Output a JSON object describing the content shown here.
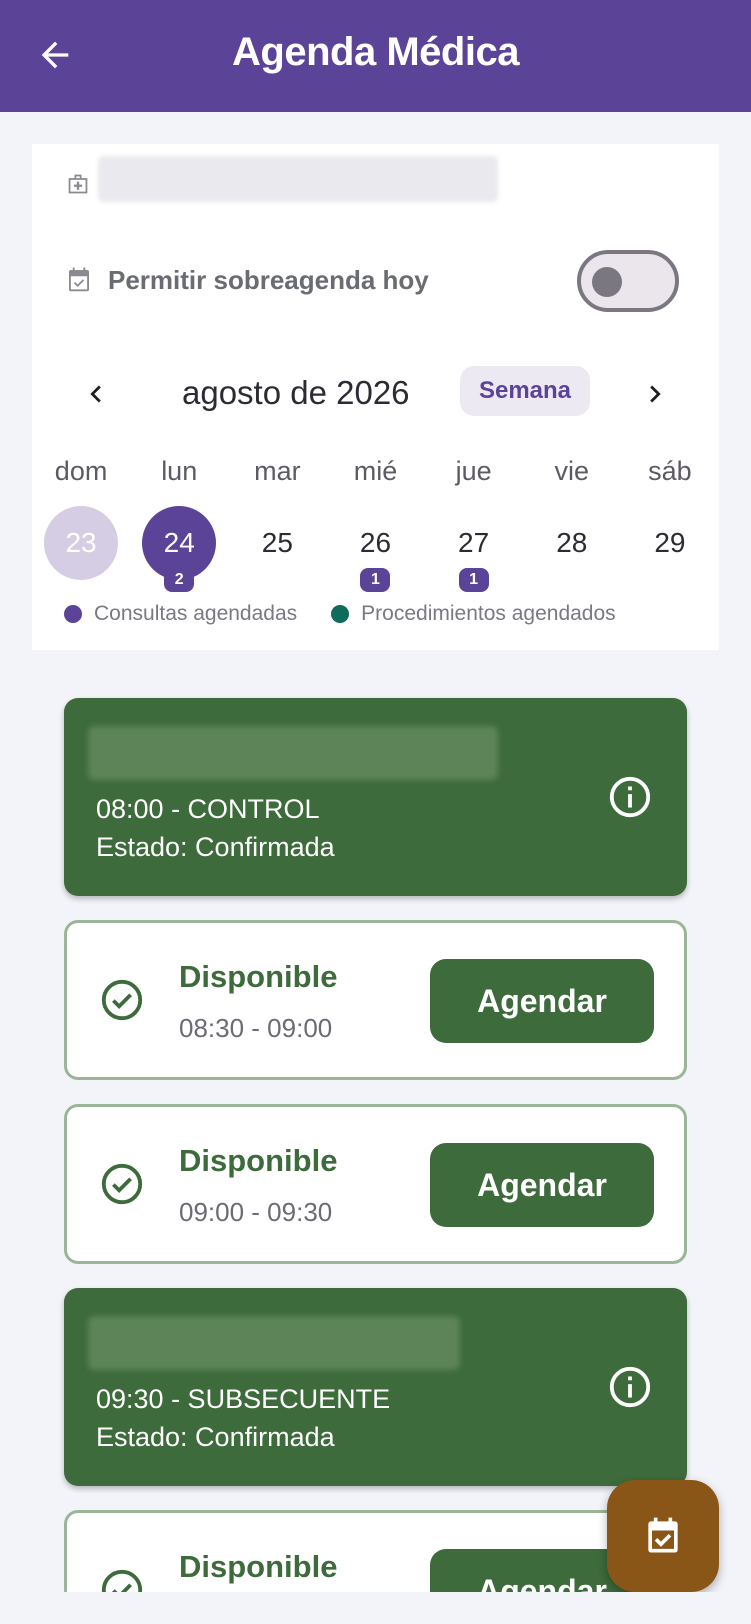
{
  "header": {
    "title": "Agenda Médica",
    "back_icon": "arrow-left-icon"
  },
  "settings": {
    "clinic_icon": "medical-bag-icon",
    "overbooking_label": "Permitir sobreagenda hoy",
    "overbooking_enabled": false
  },
  "calendar": {
    "month_label": "agosto de 2026",
    "view_mode_label": "Semana",
    "weekdays": [
      "dom",
      "lun",
      "mar",
      "mié",
      "jue",
      "vie",
      "sáb"
    ],
    "days": [
      {
        "number": "23",
        "state": "past",
        "badge": ""
      },
      {
        "number": "24",
        "state": "selected",
        "badge": "2"
      },
      {
        "number": "25",
        "state": "normal",
        "badge": ""
      },
      {
        "number": "26",
        "state": "normal",
        "badge": "1"
      },
      {
        "number": "27",
        "state": "normal",
        "badge": "1"
      },
      {
        "number": "28",
        "state": "normal",
        "badge": ""
      },
      {
        "number": "29",
        "state": "normal",
        "badge": ""
      }
    ],
    "legend": [
      {
        "label": "Consultas agendadas",
        "color": "#5b4497"
      },
      {
        "label": "Procedimientos agendados",
        "color": "#0f6b5a"
      }
    ]
  },
  "slots": [
    {
      "type": "booked",
      "line1": "08:00 - CONTROL",
      "line2": "Estado: Confirmada"
    },
    {
      "type": "free",
      "status": "Disponible",
      "range": "08:30 - 09:00",
      "button": "Agendar"
    },
    {
      "type": "free",
      "status": "Disponible",
      "range": "09:00 - 09:30",
      "button": "Agendar"
    },
    {
      "type": "booked",
      "line1": "09:30 - SUBSECUENTE",
      "line2": "Estado: Confirmada"
    },
    {
      "type": "free",
      "status": "Disponible",
      "range": "",
      "button": "Agendar"
    }
  ],
  "colors": {
    "primary": "#5b4497",
    "success": "#3d6b3b",
    "fab": "#8a5617"
  },
  "fab": {
    "icon": "calendar-check-icon"
  }
}
